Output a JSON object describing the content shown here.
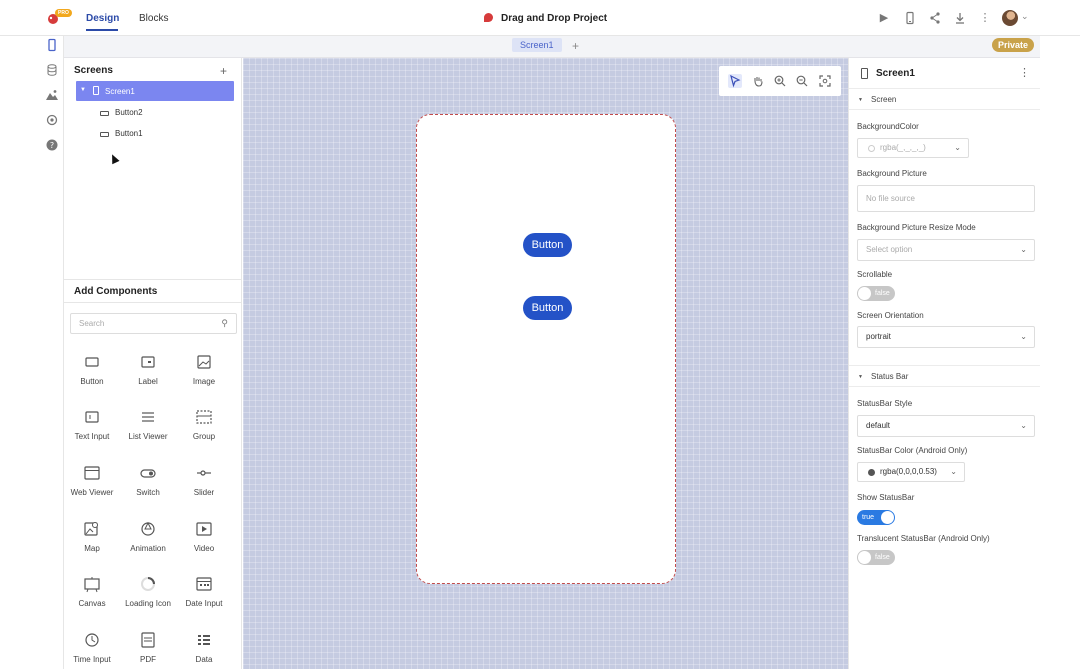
{
  "topbar": {
    "logo_badge": "PRO",
    "tabs": [
      {
        "label": "Design",
        "active": true
      },
      {
        "label": "Blocks",
        "active": false
      }
    ],
    "project_title": "Drag and Drop Project",
    "icons": [
      "play-icon",
      "phone-preview-icon",
      "share-icon",
      "download-icon",
      "more-vert-icon"
    ]
  },
  "rail": {
    "icons": [
      "mobile-icon",
      "database-icon",
      "media-icon",
      "settings-icon",
      "help-icon"
    ]
  },
  "subbar": {
    "screen_tab": "Screen1",
    "add_label": "+",
    "private_label": "Private"
  },
  "screens_panel": {
    "title": "Screens",
    "add_label": "+",
    "tree": [
      {
        "label": "Screen1",
        "selected": true
      },
      {
        "label": "Button2",
        "selected": false
      },
      {
        "label": "Button1",
        "selected": false
      }
    ]
  },
  "components_panel": {
    "title": "Add Components",
    "search_placeholder": "Search",
    "items": [
      {
        "label": "Button",
        "icon": "button-icon"
      },
      {
        "label": "Label",
        "icon": "label-icon"
      },
      {
        "label": "Image",
        "icon": "image-icon"
      },
      {
        "label": "Text Input",
        "icon": "text-input-icon"
      },
      {
        "label": "List Viewer",
        "icon": "list-viewer-icon"
      },
      {
        "label": "Group",
        "icon": "group-icon"
      },
      {
        "label": "Web Viewer",
        "icon": "web-viewer-icon"
      },
      {
        "label": "Switch",
        "icon": "switch-icon"
      },
      {
        "label": "Slider",
        "icon": "slider-icon"
      },
      {
        "label": "Map",
        "icon": "map-icon"
      },
      {
        "label": "Animation",
        "icon": "animation-icon"
      },
      {
        "label": "Video",
        "icon": "video-icon"
      },
      {
        "label": "Canvas",
        "icon": "canvas-icon"
      },
      {
        "label": "Loading Icon",
        "icon": "loading-icon"
      },
      {
        "label": "Date Input",
        "icon": "date-input-icon"
      },
      {
        "label": "Time Input",
        "icon": "time-input-icon"
      },
      {
        "label": "PDF",
        "icon": "pdf-icon"
      },
      {
        "label": "Data",
        "icon": "data-icon"
      }
    ]
  },
  "canvas": {
    "tools": [
      "pointer-icon",
      "hand-icon",
      "zoom-in-icon",
      "zoom-out-icon",
      "fit-screen-icon"
    ],
    "buttons": [
      "Button",
      "Button"
    ]
  },
  "properties": {
    "title": "Screen1",
    "section_screen": "Screen",
    "background_color_label": "BackgroundColor",
    "background_color_value": "rgba(_,_,_,_)",
    "background_picture_label": "Background Picture",
    "background_picture_placeholder": "No file source",
    "resize_mode_label": "Background Picture Resize Mode",
    "resize_mode_placeholder": "Select option",
    "scrollable_label": "Scrollable",
    "scrollable_value": "false",
    "orientation_label": "Screen Orientation",
    "orientation_value": "portrait",
    "section_status_bar": "Status Bar",
    "statusbar_style_label": "StatusBar Style",
    "statusbar_style_value": "default",
    "statusbar_color_label": "StatusBar Color (Android Only)",
    "statusbar_color_value": "rgba(0,0,0,0.53)",
    "show_statusbar_label": "Show StatusBar",
    "show_statusbar_value": "true",
    "translucent_label": "Translucent StatusBar (Android Only)",
    "translucent_value": "false"
  },
  "colors": {
    "accent": "#2b4aa8",
    "selection": "#7b86f0",
    "canvas_bg": "#c5cbe1",
    "phone_button": "#2452c7",
    "private_badge": "#c9a24a",
    "toggle_on": "#2a7ae2"
  }
}
